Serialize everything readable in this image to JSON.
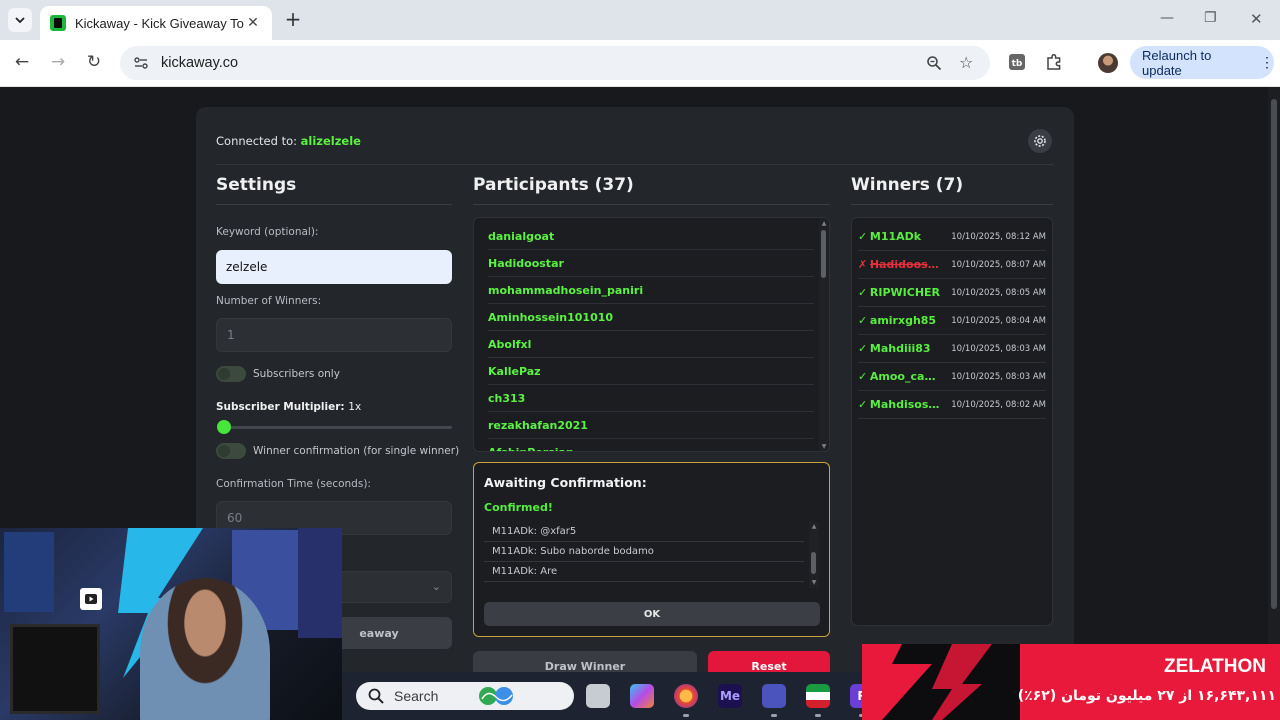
{
  "browser": {
    "tab_title": "Kickaway - Kick Giveaway Tool",
    "url": "kickaway.co",
    "relaunch_label": "Relaunch to update"
  },
  "app": {
    "connected_prefix": "Connected to: ",
    "connected_user": "alizelzele",
    "settings": {
      "title": "Settings",
      "keyword_label": "Keyword (optional):",
      "keyword_value": "zelzele",
      "winners_label": "Number of Winners:",
      "winners_value": "1",
      "subscribers_only_label": "Subscribers only",
      "multiplier_label": "Subscriber Multiplier: ",
      "multiplier_value": "1",
      "multiplier_unit": "x",
      "winner_confirmation_label": "Winner confirmation (for single winner)",
      "confirmation_time_label": "Confirmation Time (seconds):",
      "confirmation_time_value": "60",
      "start_label": "eaway"
    },
    "participants": {
      "title": "Participants (37)",
      "items": [
        "danialgoat",
        "Hadidoostar",
        "mohammadhosein_paniri",
        "Aminhossein101010",
        "Abolfxl",
        "KallePaz",
        "ch313",
        "rezakhafan2021",
        "AfshinPersian"
      ]
    },
    "confirmation": {
      "title": "Awaiting Confirmation:",
      "status": "Confirmed!",
      "messages": [
        "M11ADk: @xfar5",
        "M11ADk: Subo naborde bodamo",
        "M11ADk: Are"
      ],
      "ok_label": "OK"
    },
    "draw_label": "Draw Winner",
    "reset_label": "Reset",
    "winners": {
      "title": "Winners (7)",
      "items": [
        {
          "mark": "✓",
          "name": "M11ADk",
          "time": "10/10/2025, 08:12 AM",
          "status": "confirmed"
        },
        {
          "mark": "✗",
          "name": "Hadidoostar",
          "time": "10/10/2025, 08:07 AM",
          "status": "rejected"
        },
        {
          "mark": "✓",
          "name": "RIPWICHER",
          "time": "10/10/2025, 08:05 AM",
          "status": "confirmed"
        },
        {
          "mark": "✓",
          "name": "amirxgh85",
          "time": "10/10/2025, 08:04 AM",
          "status": "confirmed"
        },
        {
          "mark": "✓",
          "name": "Mahdiii83",
          "time": "10/10/2025, 08:03 AM",
          "status": "confirmed"
        },
        {
          "mark": "✓",
          "name": "Amoo_cactus",
          "time": "10/10/2025, 08:03 AM",
          "status": "confirmed"
        },
        {
          "mark": "✓",
          "name": "Mahdisosss",
          "time": "10/10/2025, 08:02 AM",
          "status": "confirmed"
        }
      ]
    }
  },
  "taskbar": {
    "search_label": "Search",
    "icons": [
      "file-explorer-icon",
      "copilot-icon",
      "firefox-icon",
      "media-encoder-icon",
      "teams-icon",
      "flag-app-icon",
      "r-app-icon"
    ],
    "media_encoder_text": "Me",
    "r_app_text": "R"
  },
  "promo": {
    "title": "ZELATHON",
    "subtitle": "۱۶,۶۴۳,۱۱۱ از ۲۷ میلیون تومان (۶۲٪)"
  },
  "colors": {
    "accent_green": "#58ee3e",
    "danger_red": "#e3163b",
    "confirm_border": "#c9a43b",
    "card_bg": "#23262b"
  }
}
